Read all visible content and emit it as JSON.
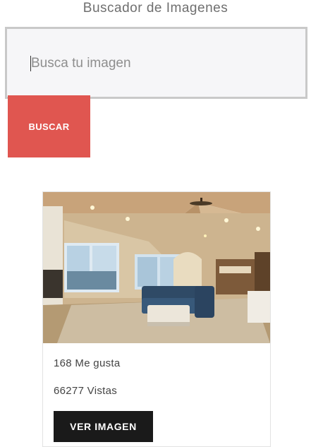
{
  "header": {
    "title": "Buscador de Imagenes"
  },
  "search": {
    "placeholder": "Busca tu imagen",
    "value": "",
    "button_label": "BUSCAR"
  },
  "colors": {
    "accent": "#e05650",
    "dark_button": "#1a1a1a",
    "input_border": "#c9c9c9"
  },
  "results": [
    {
      "image_subject": "living room interior",
      "likes": "168 Me gusta",
      "views": "66277 Vistas",
      "button_label": "VER IMAGEN"
    }
  ]
}
